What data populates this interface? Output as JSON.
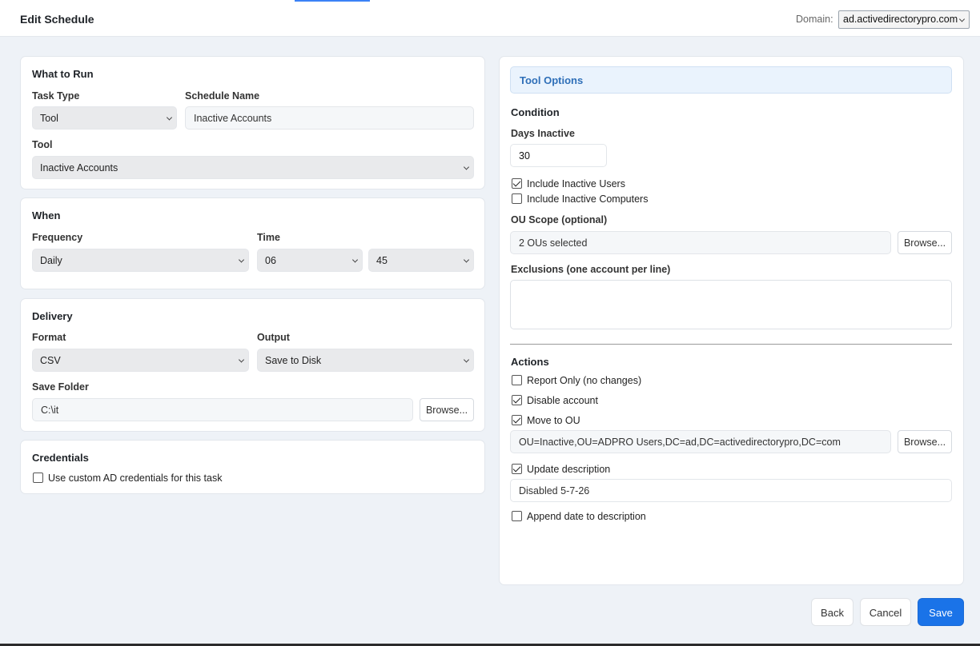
{
  "header": {
    "title": "Edit Schedule",
    "domain_label": "Domain:",
    "domain_value": "ad.activedirectorypro.com"
  },
  "what_to_run": {
    "title": "What to Run",
    "task_type_label": "Task Type",
    "task_type_value": "Tool",
    "schedule_name_label": "Schedule Name",
    "schedule_name_value": "Inactive Accounts",
    "tool_label": "Tool",
    "tool_value": "Inactive Accounts"
  },
  "when": {
    "title": "When",
    "frequency_label": "Frequency",
    "frequency_value": "Daily",
    "time_label": "Time",
    "hour_value": "06",
    "minute_value": "45"
  },
  "delivery": {
    "title": "Delivery",
    "format_label": "Format",
    "format_value": "CSV",
    "output_label": "Output",
    "output_value": "Save to Disk",
    "save_folder_label": "Save Folder",
    "save_folder_value": "C:\\it",
    "browse_label": "Browse..."
  },
  "credentials": {
    "title": "Credentials",
    "custom_creds_label": "Use custom AD credentials for this task",
    "custom_creds_checked": false
  },
  "tool_options": {
    "header": "Tool Options",
    "condition_title": "Condition",
    "days_inactive_label": "Days Inactive",
    "days_inactive_value": "30",
    "include_users_label": "Include Inactive Users",
    "include_users_checked": true,
    "include_computers_label": "Include Inactive Computers",
    "include_computers_checked": false,
    "ou_scope_label": "OU Scope (optional)",
    "ou_scope_value": "2 OUs selected",
    "browse_label": "Browse...",
    "exclusions_label": "Exclusions (one account per line)",
    "exclusions_value": ""
  },
  "actions": {
    "title": "Actions",
    "report_only_label": "Report Only (no changes)",
    "report_only_checked": false,
    "disable_label": "Disable account",
    "disable_checked": true,
    "move_label": "Move to OU",
    "move_checked": true,
    "move_ou_value": "OU=Inactive,OU=ADPRO Users,DC=ad,DC=activedirectorypro,DC=com",
    "browse_label": "Browse...",
    "update_desc_label": "Update description",
    "update_desc_checked": true,
    "description_value": "Disabled 5-7-26",
    "append_date_label": "Append date to description",
    "append_date_checked": false
  },
  "footer": {
    "back_label": "Back",
    "cancel_label": "Cancel",
    "save_label": "Save"
  },
  "colors": {
    "primary": "#1a73e8",
    "tool_header_bg": "#eaf3fd",
    "tool_header_text": "#2f6fb8",
    "page_bg": "#eef2f7"
  }
}
